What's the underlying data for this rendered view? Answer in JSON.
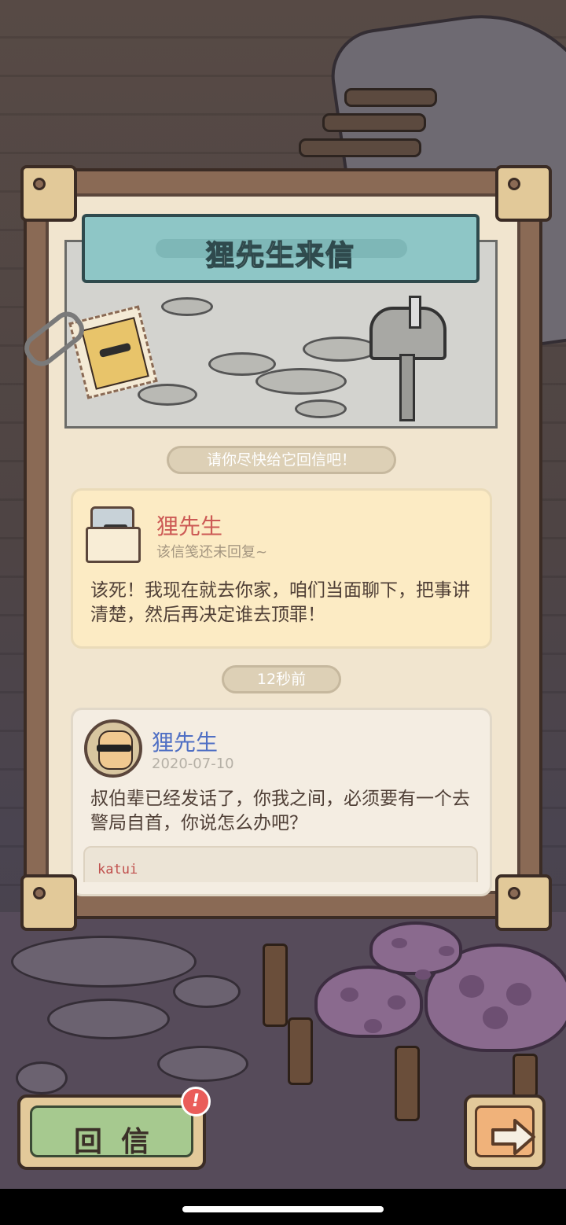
{
  "letter": {
    "title": "狸先生来信",
    "hint": "请你尽快给它回信吧！",
    "time_ago": "12秒前"
  },
  "reply_card": {
    "sender": "狸先生",
    "status": "该信笺还未回复~",
    "message": "该死！我现在就去你家，咱们当面聊下，把事讲清楚，然后再决定谁去顶罪！",
    "icon": "envelope-icon"
  },
  "message_card": {
    "sender": "狸先生",
    "date": "2020-07-10",
    "message": "叔伯辈已经发话了，你我之间，必须要有一个去警局自首，你说怎么办吧？",
    "code_text": "katui"
  },
  "buttons": {
    "reply_label": "回信",
    "reply_badge": "!",
    "next_icon": "arrow-right-icon"
  },
  "colors": {
    "title_banner": "#8ec6c6",
    "sender_red": "#cc5a55",
    "sender_blue": "#4f6fc4",
    "reply_green": "#a6c98f",
    "badge_red": "#ea5d5a"
  }
}
